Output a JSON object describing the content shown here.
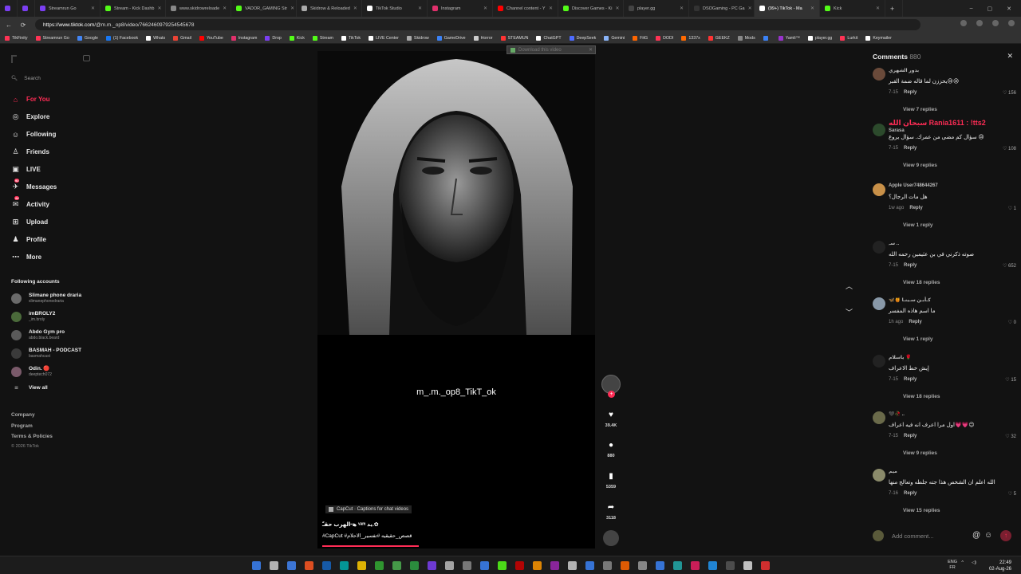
{
  "browser": {
    "tabs": [
      {
        "label": "",
        "color": "#7b3ff2",
        "active": false,
        "small": true
      },
      {
        "label": "",
        "color": "#7b3ff2",
        "active": false,
        "small": true
      },
      {
        "label": "Streamrun Go",
        "color": "#7b3ff2",
        "active": false
      },
      {
        "label": "Stream - Kick Dashb",
        "color": "#53fc18",
        "active": false
      },
      {
        "label": "www.skidrowreloade",
        "color": "#888888",
        "active": false
      },
      {
        "label": "VADOR_GAMING Str",
        "color": "#53fc18",
        "active": false
      },
      {
        "label": "Skidrow & Reloaded",
        "color": "#aaaaaa",
        "active": false
      },
      {
        "label": "TikTok Studio",
        "color": "#ffffff",
        "active": false
      },
      {
        "label": "Instagram",
        "color": "#e1306c",
        "active": false
      },
      {
        "label": "Channel content - Y",
        "color": "#ff0000",
        "active": false
      },
      {
        "label": "Discover Games - Ki",
        "color": "#53fc18",
        "active": false
      },
      {
        "label": "player.gg",
        "color": "#444444",
        "active": false
      },
      {
        "label": "DSOGaming - PC Ga",
        "color": "#333333",
        "active": false
      },
      {
        "label": "(99+) TikTok - Ma",
        "color": "#ffffff",
        "active": true
      },
      {
        "label": "Kick",
        "color": "#53fc18",
        "active": false
      }
    ],
    "new_tab": "+",
    "url_host": "https://www.tiktok.com",
    "url_path": "/@m.m._op8/video/7662460979254545678",
    "bookmarks": [
      {
        "label": "TikFinity",
        "color": "#ff3355"
      },
      {
        "label": "Streamrun Go",
        "color": "#ff3355"
      },
      {
        "label": "Google",
        "color": "#4285f4"
      },
      {
        "label": "(1) Facebook",
        "color": "#1877f2"
      },
      {
        "label": "Whats",
        "color": "#ffffff"
      },
      {
        "label": "Gmail",
        "color": "#ea4335"
      },
      {
        "label": "YouTube",
        "color": "#ff0000"
      },
      {
        "label": "Instagram",
        "color": "#e1306c"
      },
      {
        "label": "Drop",
        "color": "#7b3ff2"
      },
      {
        "label": "Kick",
        "color": "#53fc18"
      },
      {
        "label": "Stream",
        "color": "#53fc18"
      },
      {
        "label": "TikTok",
        "color": "#ffffff"
      },
      {
        "label": "LIVE Center",
        "color": "#ffffff"
      },
      {
        "label": "Skidrow",
        "color": "#aaaaaa"
      },
      {
        "label": "GameDrive",
        "color": "#3b82f6"
      },
      {
        "label": "Horror",
        "color": "#cccccc"
      },
      {
        "label": "STEAMUN",
        "color": "#ff3333"
      },
      {
        "label": "ChatGPT",
        "color": "#ffffff"
      },
      {
        "label": "DeepSeek",
        "color": "#4d6bfe"
      },
      {
        "label": "Gemini",
        "color": "#8ab4f8"
      },
      {
        "label": "FitG",
        "color": "#ff6600"
      },
      {
        "label": "DODI",
        "color": "#ff3355"
      },
      {
        "label": "1337x",
        "color": "#ff6a00"
      },
      {
        "label": "GEEKZ",
        "color": "#ff3333"
      },
      {
        "label": "Mods",
        "color": "#888888"
      },
      {
        "label": "",
        "color": "#3b82f6"
      },
      {
        "label": "Yamli™",
        "color": "#9933cc"
      },
      {
        "label": "player.gg",
        "color": "#ffffff"
      },
      {
        "label": "Lurkit",
        "color": "#ff3355"
      },
      {
        "label": "Keymailer",
        "color": "#ffffff"
      }
    ]
  },
  "sidebar": {
    "search_placeholder": "Search",
    "nav": [
      {
        "label": "For You",
        "icon": "home-icon",
        "glyph": "⌂",
        "active": true
      },
      {
        "label": "Explore",
        "icon": "compass-icon",
        "glyph": "◎"
      },
      {
        "label": "Following",
        "icon": "following-icon",
        "glyph": "☺"
      },
      {
        "label": "Friends",
        "icon": "friends-icon",
        "glyph": "♙"
      },
      {
        "label": "LIVE",
        "icon": "live-icon",
        "glyph": "▣"
      },
      {
        "label": "Messages",
        "icon": "messages-icon",
        "glyph": "✈",
        "badge": "92"
      },
      {
        "label": "Activity",
        "icon": "activity-icon",
        "glyph": "✉",
        "badge": "24"
      },
      {
        "label": "Upload",
        "icon": "upload-icon",
        "glyph": "⊞"
      },
      {
        "label": "Profile",
        "icon": "profile-icon",
        "glyph": "♟"
      },
      {
        "label": "More",
        "icon": "more-icon",
        "glyph": "⋯"
      }
    ],
    "following_header": "Following accounts",
    "following": [
      {
        "name": "Slimane phone draria",
        "handle": "slimanephonedraria"
      },
      {
        "name": "imBROLY2",
        "handle": "_im.broly"
      },
      {
        "name": "Abdo Gym pro",
        "handle": "abdo.black.beard"
      },
      {
        "name": "BASMAH - PODCAST",
        "handle": "basmahcast"
      },
      {
        "name": "Odin. 🔴",
        "handle": "deeptech072"
      }
    ],
    "view_all": "View all",
    "footer": [
      "Company",
      "Program",
      "Terms & Policies"
    ],
    "copyright": "© 2026 TikTok"
  },
  "video": {
    "download_label": "Download this video",
    "overlay_text": "m_.m._op8_TikT_ok",
    "capcut_label": "CapCut · Captions for chat videos",
    "title": "ﻫ᠆الهرب حقـّ ᵛᵃᵐ يد.✿",
    "tags": "#CapCut #قصص_حقيقيه #تفسير_الاحلام",
    "progress": 0.58
  },
  "actions": {
    "likes": "39.4K",
    "comments": "880",
    "saves": "5359",
    "shares": "3118"
  },
  "comments": {
    "header": "Comments",
    "count": "880",
    "add_placeholder": "Add comment...",
    "items": [
      {
        "user": "بدور الشهري",
        "text": "يحززن لما قاله ضمة القبر😢😢",
        "date": "7-15",
        "likes": "156",
        "replies": "View 7 replies",
        "avatar": "#6a4a3a"
      },
      {
        "user": "Sarasa",
        "highlight": "سبحان الله Rania1611 : !tts2",
        "text": "سؤال كم مضى من عمرك. سؤال يروع 😢",
        "date": "7-15",
        "likes": "108",
        "replies": "View 9 replies",
        "avatar": "#2c4a2c"
      },
      {
        "user": "Apple User748644267",
        "text": "هل مات الرجال؟",
        "date": "1w ago",
        "likes": "1",
        "replies": "View 1 reply",
        "avatar": "#c89048"
      },
      {
        "user": "ﺳﮧ ..",
        "text": "صوته ذكرني في بن عثيمين رحمه الله",
        "date": "7-15",
        "likes": "652",
        "replies": "View 18 replies",
        "avatar": "#222222"
      },
      {
        "user": "🦋🍯 ﻛـأبـن سـينـا",
        "text": "ما اسم هاذه المفسر",
        "date": "1h ago",
        "likes": "0",
        "replies": "View 1 reply",
        "avatar": "#8898a8"
      },
      {
        "user": "ياسلام 🌹",
        "text": "إيش خط الاعراف",
        "date": "7-15",
        "likes": "15",
        "replies": "View 18 replies",
        "avatar": "#222222"
      },
      {
        "user": "🖤🥀 ..",
        "text": "اول مرا اعرف انه فيه اعراف💗💗😉",
        "date": "7-15",
        "likes": "32",
        "replies": "View 9 replies",
        "avatar": "#6a6a4a"
      },
      {
        "user": "ميم",
        "text": "الله اعلم ان الشخص هذا جته جلطه وتعالج منها",
        "date": "7-16",
        "likes": "5",
        "replies": "View 15 replies",
        "avatar": "#8a8a6a"
      }
    ]
  },
  "taskbar": {
    "lang_top": "ENG",
    "lang_bottom": "FR",
    "time": "22:49",
    "date": "02-Aug-26"
  },
  "colors": {
    "accent": "#fe2c55",
    "bg": "#121212"
  }
}
